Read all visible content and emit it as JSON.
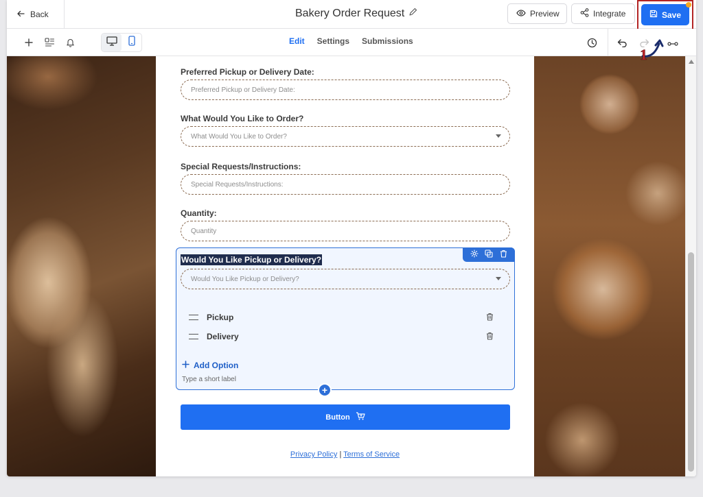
{
  "topbar": {
    "back_label": "Back",
    "title": "Bakery Order Request",
    "preview_label": "Preview",
    "integrate_label": "Integrate",
    "save_label": "Save"
  },
  "toolbar": {
    "tabs": [
      {
        "label": "Edit",
        "active": true
      },
      {
        "label": "Settings",
        "active": false
      },
      {
        "label": "Submissions",
        "active": false
      }
    ]
  },
  "annotation": {
    "step": "1"
  },
  "form": {
    "fields": [
      {
        "label": "Preferred Pickup or Delivery Date:",
        "placeholder": "Preferred Pickup or Delivery Date:",
        "type": "text"
      },
      {
        "label": "What Would You Like to Order?",
        "placeholder": "What Would You Like to Order?",
        "type": "select"
      },
      {
        "label": "Special Requests/Instructions:",
        "placeholder": "Special Requests/Instructions:",
        "type": "text"
      },
      {
        "label": "Quantity:",
        "placeholder": "Quantity",
        "type": "text"
      }
    ],
    "selected_field": {
      "label": "Would You Like Pickup or Delivery?",
      "placeholder": "Would You Like Pickup or Delivery?",
      "options": [
        "Pickup",
        "Delivery"
      ],
      "add_option_label": "Add Option",
      "hint": "Type a short label"
    },
    "submit_label": "Button",
    "footer": {
      "privacy": "Privacy Policy",
      "separator": "|",
      "terms": "Terms of Service"
    }
  },
  "colors": {
    "accent": "#1f6ff2",
    "selection_border": "#2d6fd8",
    "annotation_red": "#b32424"
  }
}
